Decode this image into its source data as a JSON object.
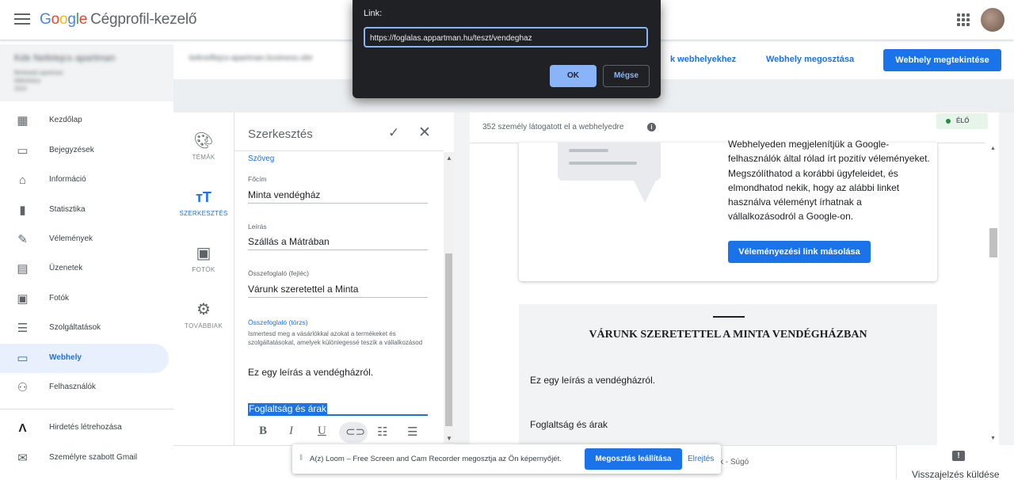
{
  "header": {
    "brand": "Google",
    "product": "Cégprofil-kezelő",
    "links": [
      "k webhelyekhez",
      "Webhely megosztása"
    ],
    "view_button": "Webhely megtekintése"
  },
  "business": {
    "name": "Kék Nefelejcs apartman",
    "lines": [
      "Bérbeadó apartman",
      "Mátraháza",
      "2024"
    ],
    "url": "kekneflejcs-apartman.business.site"
  },
  "sidebar": {
    "items": [
      {
        "label": "Kezdőlap",
        "icon": "dashboard-icon"
      },
      {
        "label": "Bejegyzések",
        "icon": "posts-icon"
      },
      {
        "label": "Információ",
        "icon": "store-icon"
      },
      {
        "label": "Statisztika",
        "icon": "bar-chart-icon"
      },
      {
        "label": "Vélemények",
        "icon": "reviews-icon"
      },
      {
        "label": "Üzenetek",
        "icon": "message-icon"
      },
      {
        "label": "Fotók",
        "icon": "photo-icon"
      },
      {
        "label": "Szolgáltatások",
        "icon": "list-icon"
      },
      {
        "label": "Webhely",
        "icon": "web-icon"
      },
      {
        "label": "Felhasználók",
        "icon": "add-user-icon"
      }
    ],
    "bottom": [
      {
        "label": "Hirdetés létrehozása",
        "icon": "ads-icon"
      },
      {
        "label": "Személyre szabott Gmail",
        "icon": "gmail-icon"
      }
    ]
  },
  "editor_tabs": [
    {
      "label": "TÉMÁK",
      "icon": "palette-icon"
    },
    {
      "label": "SZERKESZTÉS",
      "icon": "text-format-icon"
    },
    {
      "label": "FOTÓK",
      "icon": "add-photo-icon"
    },
    {
      "label": "TOVÁBBIAK",
      "icon": "settings-icon"
    }
  ],
  "editor": {
    "title": "Szerkesztés",
    "section": "Szöveg",
    "fields": [
      {
        "label": "Főcím",
        "value": "Minta vendégház"
      },
      {
        "label": "Leírás",
        "value": "Szállás a Mátrában"
      },
      {
        "label": "Összefoglaló (fejléc)",
        "value": "Várunk szeretettel a Minta"
      }
    ],
    "summary_body": {
      "label": "Összefoglaló (törzs)",
      "hint": "Ismertesd meg a vásárlókkal azokat a termékeket és szolgáltatásokat, amelyek különlegessé teszik a vállalkozásod",
      "line1": "Ez egy leírás a vendégházról.",
      "selected": "Foglaltság és árak"
    },
    "format_tools": [
      "B",
      "I",
      "U"
    ]
  },
  "preview": {
    "visitors": "352 személy látogatott el a webhelyedre",
    "live": "ÉLŐ",
    "review_text": "Webhelyeden megjelenítjük a Google-felhasználók által rólad írt pozitív véleményeket. Megszólíthatod a korábbi ügyfeleidet, és elmondhatod nekik, hogy az alábbi linket használva véleményt írhatnak a vállalkozásodról a Google-on.",
    "review_button": "Véleményezési link másolása",
    "about_heading": "VÁRUNK SZERETETTEL A MINTA VENDÉGHÁZBAN",
    "about_p1": "Ez egy leírás a vendégházról.",
    "about_p2": "Foglaltság és árak"
  },
  "link_dialog": {
    "label": "Link:",
    "value": "https://foglalas.appartman.hu/teszt/vendeghaz",
    "ok": "OK",
    "cancel": "Mégse"
  },
  "footer": {
    "links": "k  -  Súgó",
    "feedback": "Visszajelzés küldése"
  },
  "loom": {
    "text": "A(z) Loom – Free Screen and Cam Recorder megosztja az Ön képernyőjét.",
    "stop": "Megosztás leállítása",
    "hide": "Elrejtés"
  },
  "colors": {
    "accent": "#1a73e8",
    "active_bg": "#e8f0fe",
    "live_green": "#1e8e3e"
  }
}
